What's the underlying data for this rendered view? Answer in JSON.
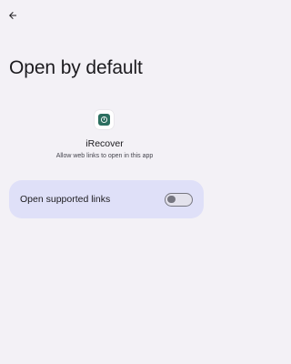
{
  "header": {
    "back_icon": "arrow-back-icon",
    "title": "Open by default"
  },
  "app": {
    "icon": "irecover-app-icon",
    "name": "iRecover",
    "description": "Allow web links to open in this app"
  },
  "setting": {
    "label": "Open supported links",
    "toggle_on": false
  },
  "colors": {
    "background": "#f3f1f6",
    "card": "#dfe0f8",
    "app_icon_accent": "#2c6f60",
    "toggle_outline": "#767680"
  }
}
